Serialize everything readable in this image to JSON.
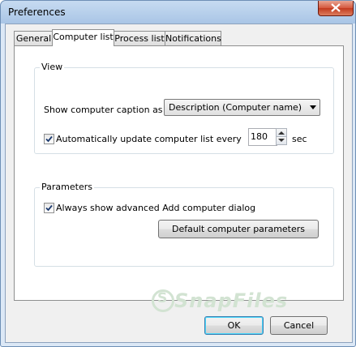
{
  "window": {
    "title": "Preferences"
  },
  "tabs": [
    {
      "label": "General",
      "active": false
    },
    {
      "label": "Computer list",
      "active": true
    },
    {
      "label": "Process list",
      "active": false
    },
    {
      "label": "Notifications",
      "active": false
    }
  ],
  "view_group": {
    "label": "View",
    "caption_label": "Show computer caption as",
    "caption_value": "Description (Computer name)",
    "auto_update": {
      "checked": true,
      "label": "Automatically update computer list every",
      "value": "180",
      "unit": "sec"
    }
  },
  "params_group": {
    "label": "Parameters",
    "always_show": {
      "checked": true,
      "label": "Always show advanced Add computer dialog"
    },
    "default_button": "Default computer parameters"
  },
  "buttons": {
    "ok": "OK",
    "cancel": "Cancel"
  },
  "watermark": {
    "text": "SnapFiles",
    "logo_letter": "S"
  }
}
